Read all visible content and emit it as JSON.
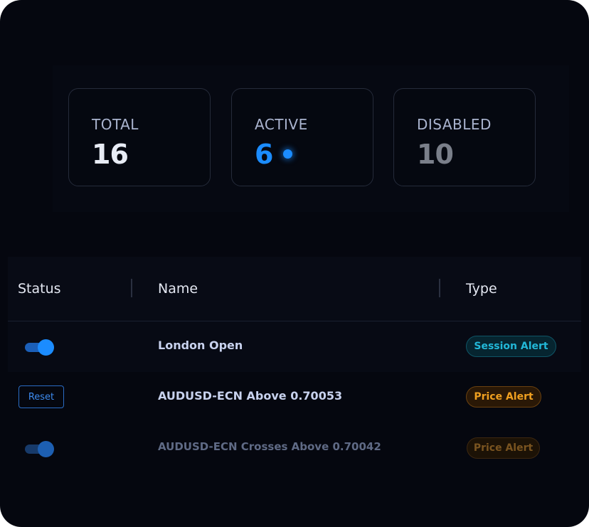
{
  "stats": {
    "total": {
      "label": "TOTAL",
      "value": "16"
    },
    "active": {
      "label": "ACTIVE",
      "value": "6"
    },
    "disabled": {
      "label": "DISABLED",
      "value": "10"
    }
  },
  "table": {
    "columns": {
      "status": "Status",
      "name": "Name",
      "type": "Type"
    },
    "rows": [
      {
        "status": "toggle-on",
        "name": "London Open",
        "type": "Session Alert"
      },
      {
        "status": "reset",
        "status_label": "Reset",
        "name": "AUDUSD-ECN Above 0.70053",
        "type": "Price Alert"
      },
      {
        "status": "toggle-on-dim",
        "name": "AUDUSD-ECN Crosses Above 0.70042",
        "type": "Price Alert"
      }
    ]
  },
  "colors": {
    "background": "#05070f",
    "accent": "#1b8cff",
    "session_badge": "#22b8d8",
    "price_badge": "#f0a020"
  }
}
